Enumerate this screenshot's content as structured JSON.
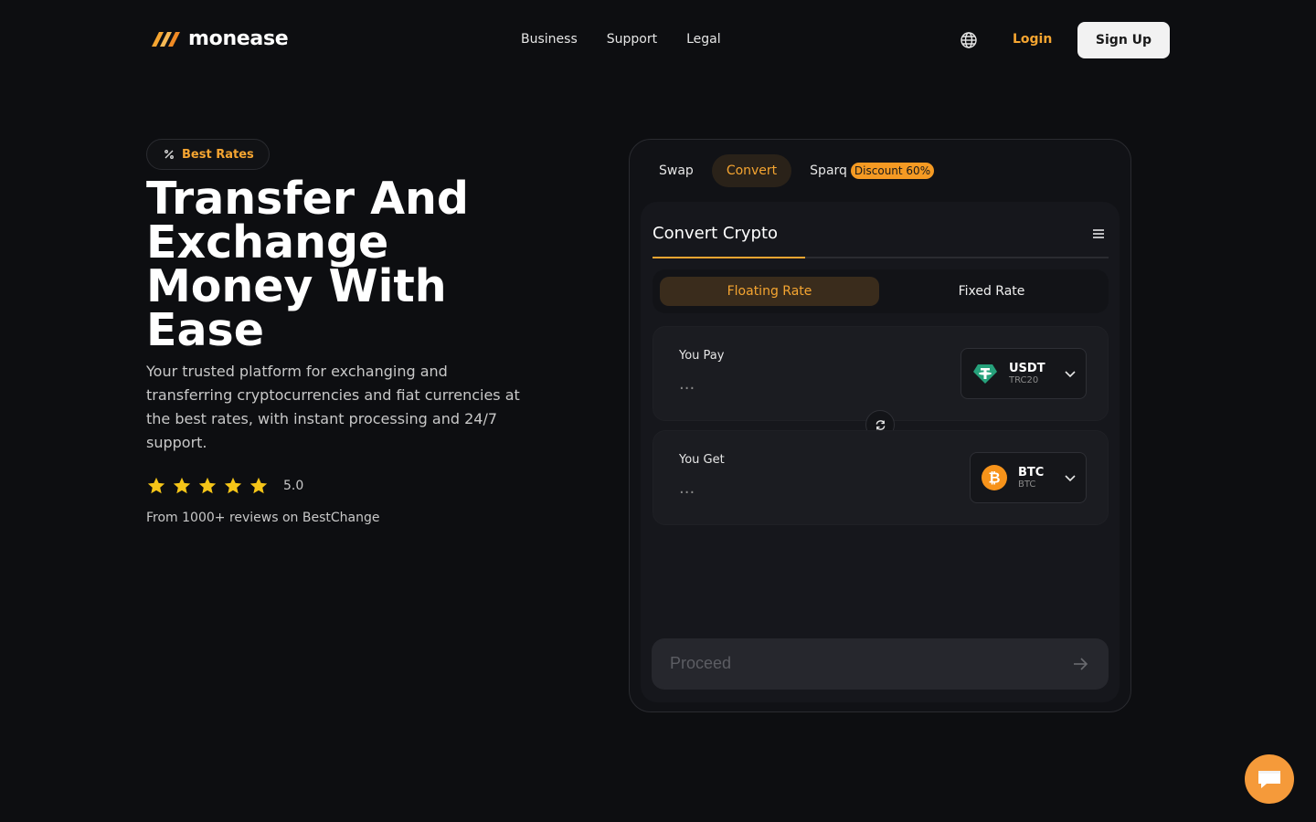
{
  "header": {
    "logo_text": "monease",
    "nav": [
      "Business",
      "Support",
      "Legal"
    ],
    "login_label": "Login",
    "signup_label": "Sign Up"
  },
  "hero": {
    "badge": "Best Rates",
    "title": "Transfer And Exchange Money With Ease",
    "description": "Your trusted platform for exchanging and transferring cryptocurrencies and fiat currencies at the best rates, with instant processing and 24/7 support.",
    "rating": {
      "stars": 5,
      "value": "5.0"
    },
    "reviews": "From 1000+ reviews on BestChange"
  },
  "widget": {
    "tabs": {
      "swap": "Swap",
      "convert": "Convert",
      "sparq": "Sparq",
      "sparq_badge": "Discount 60%",
      "active": "convert"
    },
    "panel_title": "Convert Crypto",
    "rate_toggle": {
      "floating": "Floating Rate",
      "fixed": "Fixed Rate",
      "active": "floating"
    },
    "pay": {
      "label": "You Pay",
      "placeholder": "...",
      "coin": "USDT",
      "network": "TRC20"
    },
    "get": {
      "label": "You Get",
      "placeholder": "...",
      "coin": "BTC",
      "network": "BTC"
    },
    "proceed_label": "Proceed"
  },
  "colors": {
    "background": "#0d0e11",
    "accent": "#f5a531",
    "tether": "#26a17b",
    "bitcoin": "#f7931a"
  },
  "icons": [
    "logo-icon",
    "globe-icon",
    "percent-icon",
    "star-icon",
    "menu-icon",
    "tether-icon",
    "bitcoin-icon",
    "chevron-down-icon",
    "refresh-icon",
    "arrow-right-icon",
    "chat-icon"
  ]
}
